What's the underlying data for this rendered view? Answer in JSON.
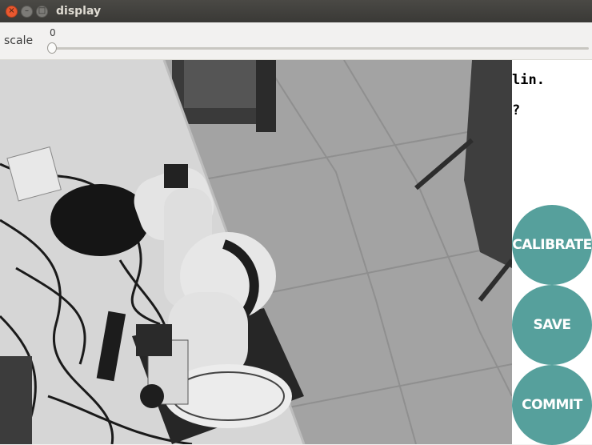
{
  "window": {
    "title": "display",
    "close_glyph": "×",
    "minimize_glyph": "–",
    "maximize_glyph": "□"
  },
  "trackbar": {
    "label": "scale",
    "value": "0",
    "level": 0
  },
  "camera": {
    "description_icon": "camera-frame",
    "colors": {
      "floor": "#9c9c9c",
      "table": "#d8d8d8",
      "robot": "#e6e6e6",
      "base": "#2a2a2a"
    }
  },
  "side": {
    "line1": "lin.",
    "line2": "?",
    "buttons": {
      "calibrate": "CALIBRATE",
      "save": "SAVE",
      "commit": "COMMIT"
    },
    "button_color": "#56a09c"
  }
}
